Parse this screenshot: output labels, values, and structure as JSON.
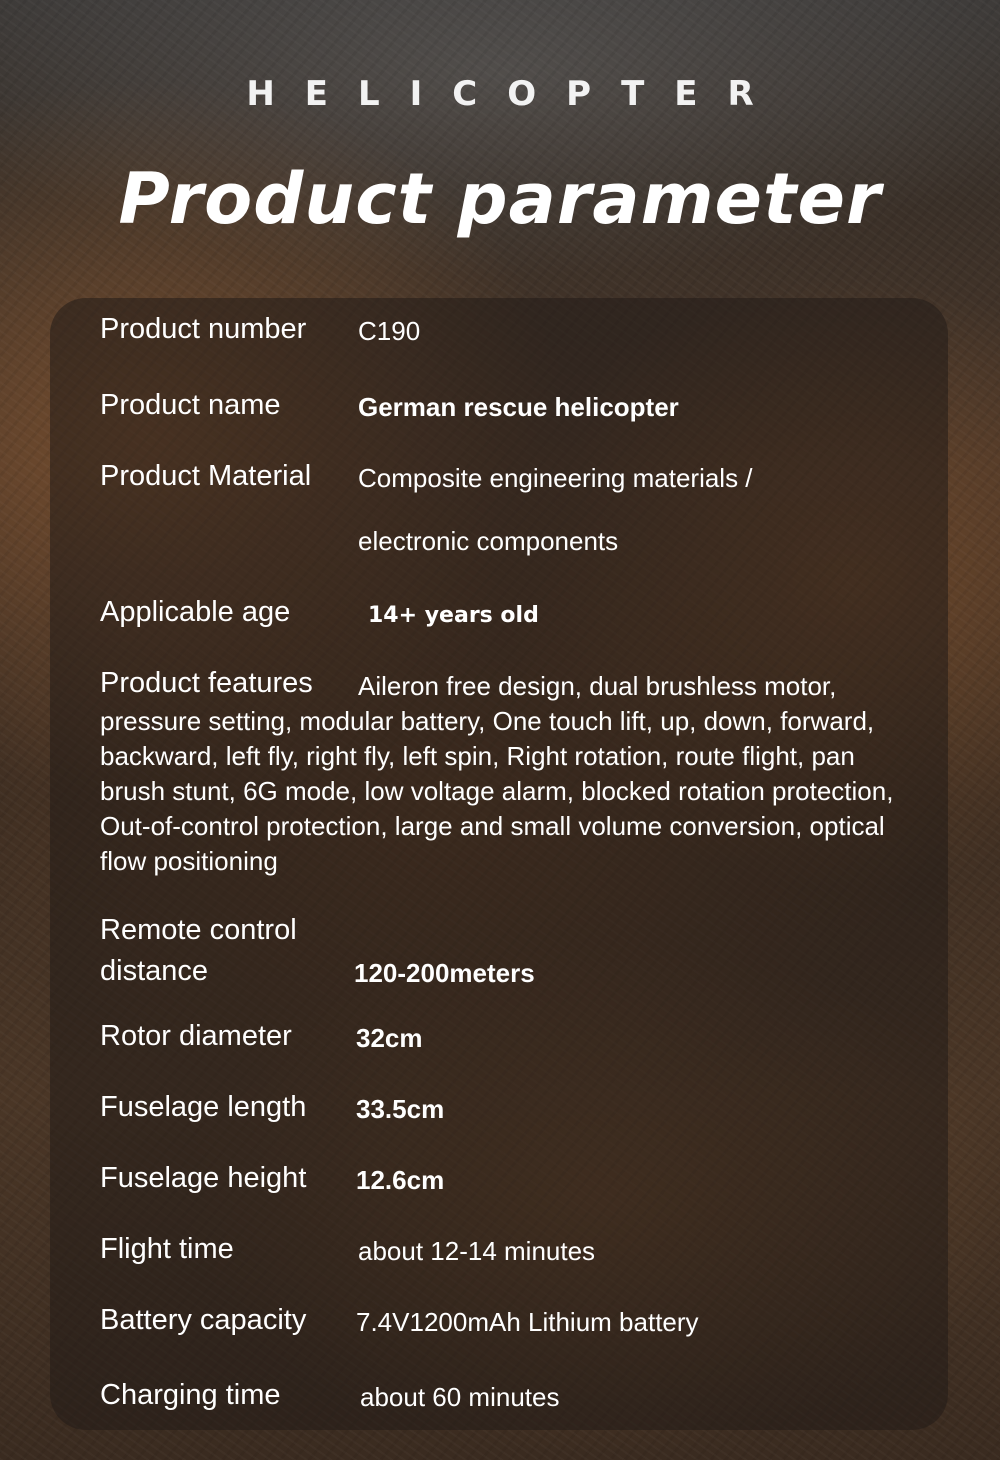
{
  "header": {
    "wordmark": "HELICOPTER",
    "title": "Product parameter"
  },
  "params": {
    "product_number": {
      "label": "Product number",
      "value": "C190"
    },
    "product_name": {
      "label": "Product name",
      "value": "German rescue helicopter"
    },
    "product_material": {
      "label": "Product Material",
      "value_line1": "Composite engineering materials  /",
      "value_line2": "electronic components"
    },
    "applicable_age": {
      "label": "Applicable age",
      "value": "14+ years old"
    },
    "product_features": {
      "label": "Product features",
      "value": "Aileron free design, dual brushless motor, pressure setting, modular battery, One touch lift, up, down, forward, backward, left fly, right fly, left spin, Right rotation, route flight, pan brush stunt, 6G mode, low voltage alarm, blocked rotation protection, Out-of-control protection, large and small volume conversion, optical flow positioning"
    },
    "remote_distance": {
      "label_line1": "Remote control",
      "label_line2": "distance",
      "value": "120-200meters"
    },
    "rotor_diameter": {
      "label": "Rotor diameter",
      "value": "32cm"
    },
    "fuselage_length": {
      "label": "Fuselage length",
      "value": "33.5cm"
    },
    "fuselage_height": {
      "label": "Fuselage height",
      "value": "12.6cm"
    },
    "flight_time": {
      "label": "Flight time",
      "value": "about 12-14 minutes"
    },
    "battery_capacity": {
      "label": "Battery capacity",
      "value": "7.4V1200mAh Lithium battery"
    },
    "charging_time": {
      "label": "Charging time",
      "value": "about 60 minutes"
    }
  }
}
